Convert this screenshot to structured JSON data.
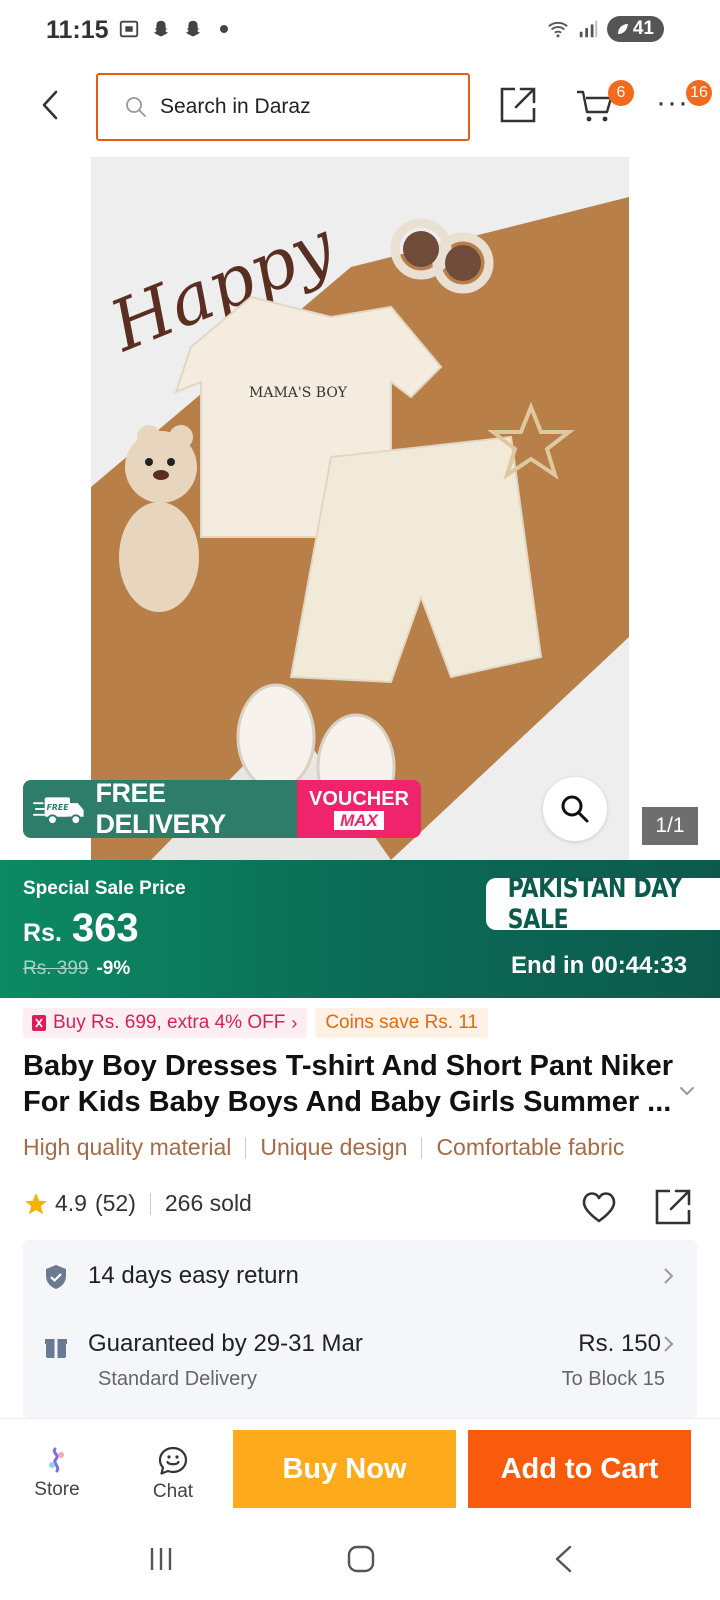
{
  "status_bar": {
    "time": "11:15",
    "battery": "41"
  },
  "search": {
    "placeholder": "Search in Daraz"
  },
  "badges": {
    "cart_count": "6",
    "more_count": "16"
  },
  "gallery": {
    "page_indicator": "1/1"
  },
  "promo": {
    "free_delivery": "FREE DELIVERY",
    "free_small": "FREE",
    "voucher_top": "VOUCHER",
    "voucher_bottom": "MAX"
  },
  "price": {
    "label": "Special Sale Price",
    "currency": "Rs.",
    "value": "363",
    "original": "Rs. 399",
    "discount": "-9%"
  },
  "campaign": {
    "name": "PAKISTAN DAY SALE",
    "countdown": "End in 00:44:33"
  },
  "offers": {
    "extra": "Buy Rs. 699, extra 4% OFF",
    "coins": "Coins save Rs. 11"
  },
  "product": {
    "title": "Baby Boy Dresses T-shirt And Short Pant Niker For Kids Baby Boys And Baby Girls Summer ...",
    "features": [
      "High quality material",
      "Unique design",
      "Comfortable fabric"
    ],
    "rating": "4.9",
    "reviews": "(52)",
    "sold": "266 sold"
  },
  "service": {
    "return_policy": "14 days easy return",
    "delivery_guarantee": "Guaranteed by 29-31 Mar",
    "delivery_type": "Standard Delivery",
    "delivery_fee": "Rs. 150",
    "delivery_to": "To Block 15"
  },
  "actions": {
    "store": "Store",
    "chat": "Chat",
    "buy_now": "Buy Now",
    "add_to_cart": "Add to Cart"
  },
  "image_text": {
    "happy": "Happy",
    "print": "MAMA'S BOY"
  },
  "colors": {
    "accent": "#f85b0b",
    "buy_now": "#fdab1d",
    "price_band": "#0b6a55",
    "search_border": "#e65c17"
  }
}
